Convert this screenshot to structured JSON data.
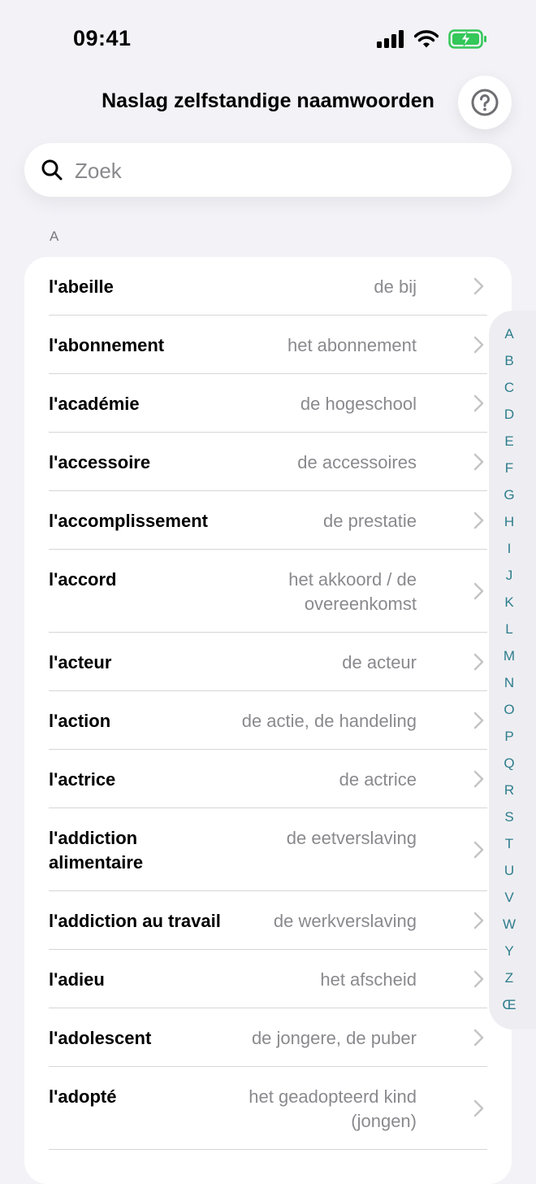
{
  "status_bar": {
    "time": "09:41"
  },
  "nav": {
    "title": "Naslag zelfstandige naamwoorden"
  },
  "search": {
    "placeholder": "Zoek",
    "value": ""
  },
  "section": {
    "header": "A"
  },
  "rows": [
    {
      "fr": "l'abeille",
      "nl": "de bij"
    },
    {
      "fr": "l'abonnement",
      "nl": "het abonnement"
    },
    {
      "fr": "l'académie",
      "nl": "de hogeschool"
    },
    {
      "fr": "l'accessoire",
      "nl": "de accessoires"
    },
    {
      "fr": "l'accomplissement",
      "nl": "de prestatie"
    },
    {
      "fr": "l'accord",
      "nl": "het akkoord / de overeenkomst",
      "tall": true
    },
    {
      "fr": "l'acteur",
      "nl": "de acteur"
    },
    {
      "fr": "l'action",
      "nl": "de actie, de handeling"
    },
    {
      "fr": "l'actrice",
      "nl": "de actrice"
    },
    {
      "fr": "l'addiction alimentaire",
      "nl": "de eetverslaving",
      "tall": true
    },
    {
      "fr": "l'addiction au travail",
      "nl": "de werkverslaving"
    },
    {
      "fr": "l'adieu",
      "nl": "het afscheid"
    },
    {
      "fr": "l'adolescent",
      "nl": "de jongere, de puber"
    },
    {
      "fr": "l'adopté",
      "nl": "het geadopteerd kind (jongen)",
      "tall": true
    },
    {
      "fr": "",
      "nl": ""
    }
  ],
  "index": [
    "A",
    "B",
    "C",
    "D",
    "E",
    "F",
    "G",
    "H",
    "I",
    "J",
    "K",
    "L",
    "M",
    "N",
    "O",
    "P",
    "Q",
    "R",
    "S",
    "T",
    "U",
    "V",
    "W",
    "Y",
    "Z",
    "Œ"
  ],
  "colors": {
    "accent": "#2d7d8c",
    "battery": "#34c759",
    "secondary_text": "#8a8a8e",
    "background": "#f2f2f7"
  },
  "icons": {
    "help": "question-circle-icon",
    "search": "magnifier-icon",
    "chevron": "chevron-right-icon",
    "battery": "battery-charging-icon"
  }
}
